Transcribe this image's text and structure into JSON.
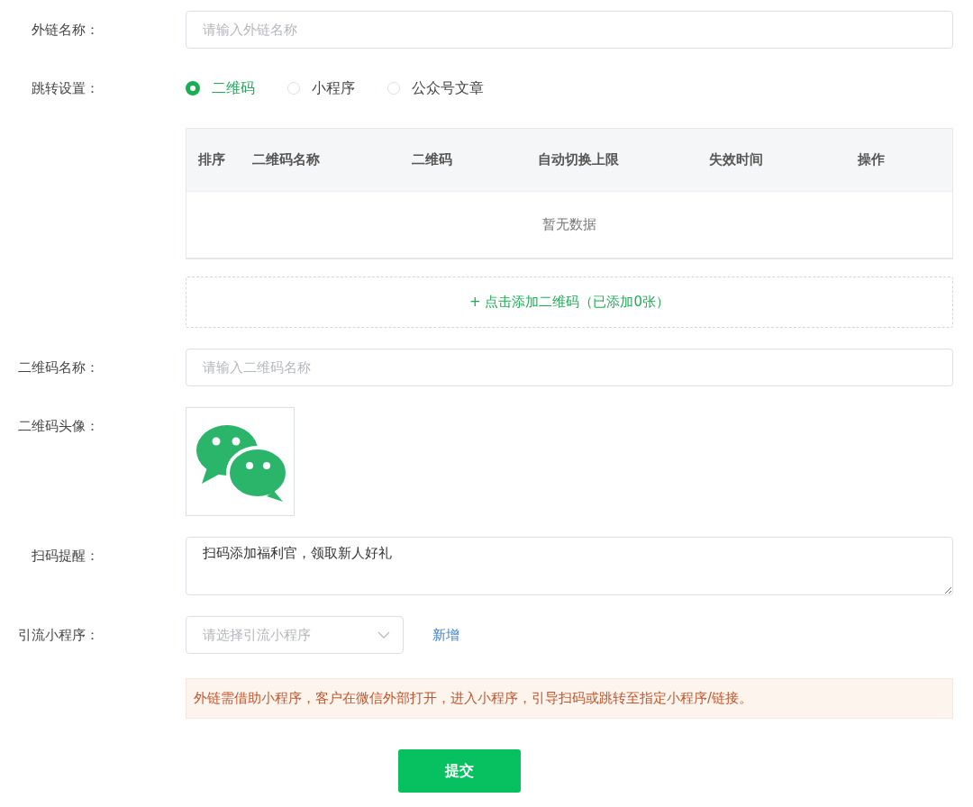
{
  "link_name": {
    "label": "外链名称：",
    "placeholder": "请输入外链名称"
  },
  "redirect": {
    "label": "跳转设置：",
    "options": [
      {
        "label": "二维码",
        "selected": true
      },
      {
        "label": "小程序",
        "selected": false
      },
      {
        "label": "公众号文章",
        "selected": false
      }
    ]
  },
  "qr_table": {
    "columns": [
      "排序",
      "二维码名称",
      "二维码",
      "自动切换上限",
      "失效时间",
      "操作"
    ],
    "empty_text": "暂无数据"
  },
  "add_qr_button": "+ 点击添加二维码（已添加0张）",
  "qr_name": {
    "label": "二维码名称：",
    "placeholder": "请输入二维码名称"
  },
  "qr_avatar": {
    "label": "二维码头像："
  },
  "scan_reminder": {
    "label": "扫码提醒：",
    "value": "扫码添加福利官，领取新人好礼"
  },
  "traffic_miniprogram": {
    "label": "引流小程序：",
    "placeholder": "请选择引流小程序",
    "add_link": "新增"
  },
  "notice": "外链需借助小程序，客户在微信外部打开，进入小程序，引导扫码或跳转至指定小程序/链接。",
  "submit": "提交"
}
